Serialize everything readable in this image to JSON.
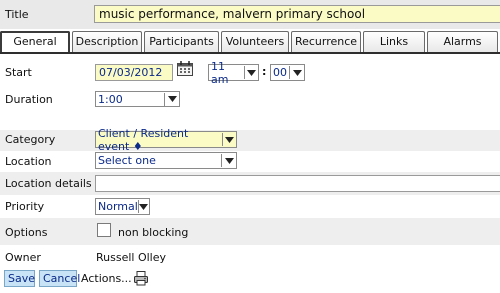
{
  "title": {
    "label": "Title",
    "value": "music performance, malvern primary school"
  },
  "tabs": [
    {
      "label": "General"
    },
    {
      "label": "Description"
    },
    {
      "label": "Participants"
    },
    {
      "label": "Volunteers"
    },
    {
      "label": "Recurrence"
    },
    {
      "label": "Links"
    },
    {
      "label": "Alarms"
    }
  ],
  "form": {
    "start": {
      "label": "Start",
      "date": "07/03/2012",
      "hour": "11 am",
      "separator": ":",
      "minute": "00"
    },
    "duration": {
      "label": "Duration",
      "value": "1:00"
    },
    "category": {
      "label": "Category",
      "value": "Client / Resident event ♦"
    },
    "location": {
      "label": "Location",
      "value": "Select one"
    },
    "location_details": {
      "label": "Location details",
      "value": ""
    },
    "priority": {
      "label": "Priority",
      "value": "Normal"
    },
    "options": {
      "label": "Options",
      "non_blocking": "non blocking",
      "checked": false
    }
  },
  "owner": {
    "label": "Owner",
    "value": "Russell Olley"
  },
  "actions": {
    "save": "Save",
    "cancel": "Cancel",
    "actions": "Actions..."
  },
  "colors": {
    "field_yellow": "#fbfbc6",
    "button_blue": "#c7e3f5",
    "text_blue": "#0b2a8a"
  }
}
